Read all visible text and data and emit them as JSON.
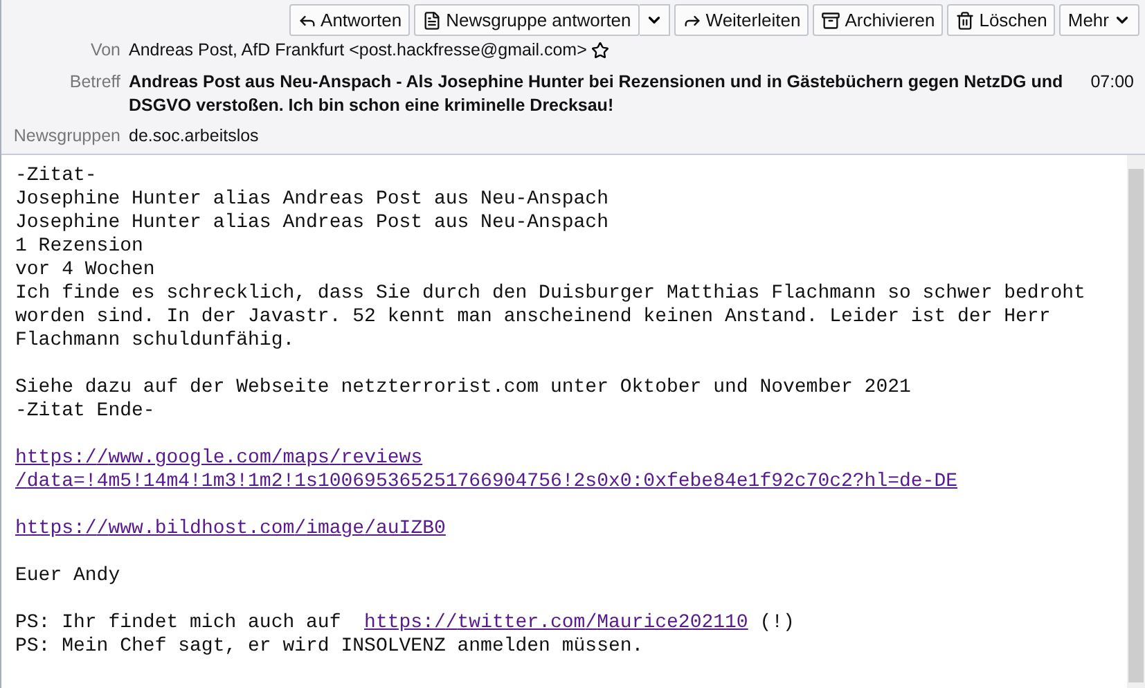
{
  "toolbar": {
    "buttons": [
      {
        "kind": "reply",
        "label": "Antworten"
      },
      {
        "kind": "group-reply",
        "label": "Newsgruppe antworten"
      },
      {
        "kind": "forward",
        "label": "Weiterleiten"
      },
      {
        "kind": "archive",
        "label": "Archivieren"
      },
      {
        "kind": "delete",
        "label": "Löschen"
      },
      {
        "kind": "more",
        "label": "Mehr"
      }
    ]
  },
  "header": {
    "from_label": "Von",
    "from": "Andreas Post, AfD Frankfurt <post.hackfresse@gmail.com>",
    "starred": false,
    "subject_label": "Betreff",
    "subject": "Andreas Post aus Neu-Anspach - Als Josephine Hunter bei Rezensionen und in Gästebüchern gegen NetzDG und DSGVO verstoßen. Ich bin schon eine kriminelle Drecksau!",
    "time": "07:00",
    "newsgroups_label": "Newsgruppen",
    "newsgroups": "de.soc.arbeitslos"
  },
  "body": {
    "lines": [
      {
        "kind": "text",
        "text": "-Zitat-"
      },
      {
        "kind": "text",
        "text": "Josephine Hunter alias Andreas Post aus Neu-Anspach"
      },
      {
        "kind": "text",
        "text": "Josephine Hunter alias Andreas Post aus Neu-Anspach"
      },
      {
        "kind": "text",
        "text": "1 Rezension"
      },
      {
        "kind": "text",
        "text": "vor 4 Wochen"
      },
      {
        "kind": "text",
        "text": "Ich finde es schrecklich, dass Sie durch den Duisburger Matthias Flachmann so schwer bedroht worden sind. In der Javastr. 52 kennt man anscheinend keinen Anstand. Leider ist der Herr Flachmann schuldunfähig."
      },
      {
        "kind": "blank"
      },
      {
        "kind": "text",
        "text": "Siehe dazu auf der Webseite netzterrorist.com unter Oktober und November 2021"
      },
      {
        "kind": "text",
        "text": "-Zitat Ende-"
      },
      {
        "kind": "blank"
      },
      {
        "kind": "link",
        "text": "https://www.google.com/maps/reviews/data=!4m5!14m4!1m3!1m2!1s100695365251766904756!2s0x0:0xfebe84e1f92c70c2?hl=de-DE"
      },
      {
        "kind": "blank"
      },
      {
        "kind": "link",
        "text": "https://www.bildhost.com/image/auIZB0"
      },
      {
        "kind": "blank"
      },
      {
        "kind": "text",
        "text": "Euer Andy"
      },
      {
        "kind": "blank"
      },
      {
        "kind": "mixed",
        "parts": [
          {
            "kind": "text",
            "text": "PS: Ihr findet mich auch auf "
          },
          {
            "kind": "link",
            "text": "https://twitter.com/Maurice202110"
          },
          {
            "kind": "text",
            "text": "(!)"
          }
        ]
      },
      {
        "kind": "text",
        "text": "PS: Mein Chef sagt, er wird INSOLVENZ anmelden müssen."
      }
    ]
  }
}
